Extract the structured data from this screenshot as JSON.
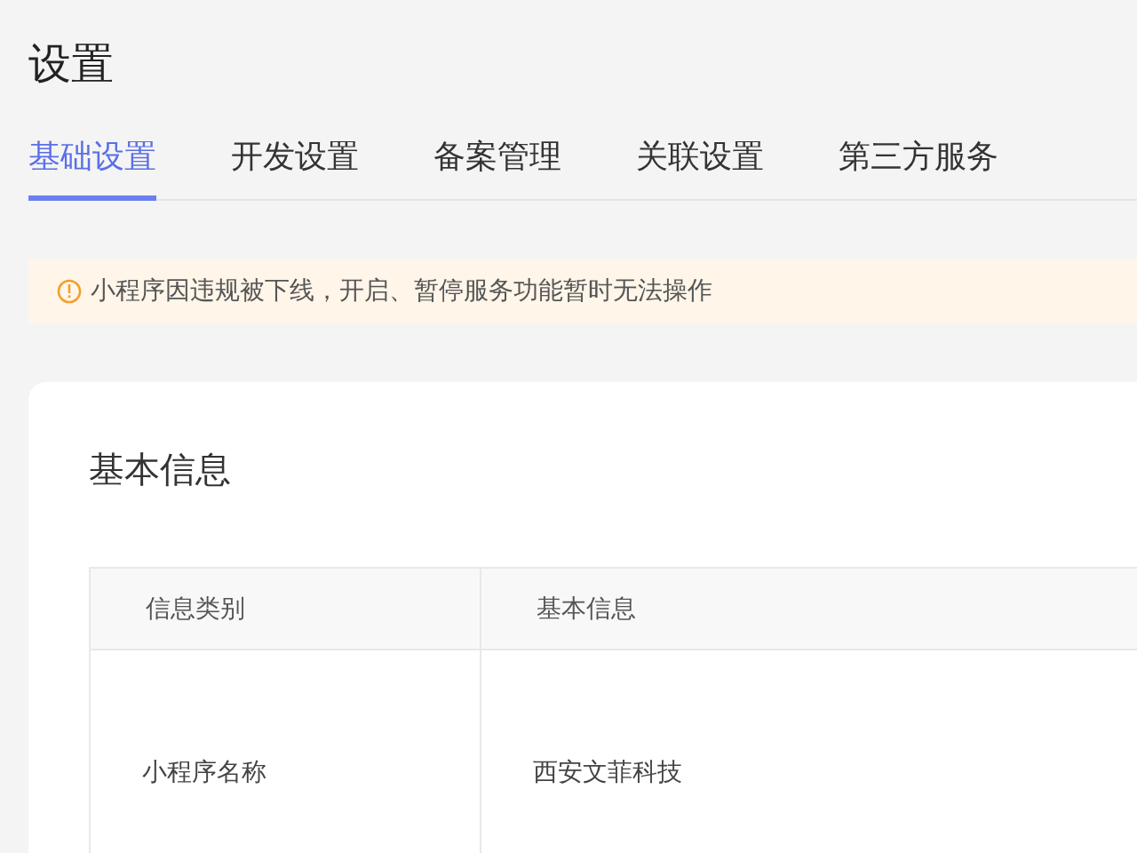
{
  "page": {
    "title": "设置"
  },
  "tabs": [
    {
      "label": "基础设置",
      "selected": true
    },
    {
      "label": "开发设置",
      "selected": false
    },
    {
      "label": "备案管理",
      "selected": false
    },
    {
      "label": "关联设置",
      "selected": false
    },
    {
      "label": "第三方服务",
      "selected": false
    }
  ],
  "alert": {
    "kind": "warning",
    "message": "小程序因违规被下线，开启、暂停服务功能暂时无法操作"
  },
  "card": {
    "title": "基本信息",
    "table": {
      "columns": [
        "信息类别",
        "基本信息"
      ],
      "rows": [
        [
          "小程序名称",
          "西安文菲科技"
        ]
      ]
    }
  }
}
